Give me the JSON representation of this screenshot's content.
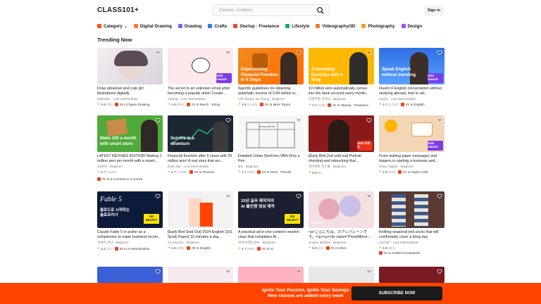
{
  "header": {
    "logo": "CLASS101+",
    "search_placeholder": "Classes, Creators",
    "signin_label": "Sign in"
  },
  "categories": [
    {
      "label": "Category",
      "color": "#ff5500"
    },
    {
      "label": "Digital Drawing",
      "color": "#ff7a33"
    },
    {
      "label": "Drawing",
      "color": "#8a5cf5"
    },
    {
      "label": "Crafts",
      "color": "#2b7de9"
    },
    {
      "label": "Startup · Freelance",
      "color": "#e84a2e"
    },
    {
      "label": "Lifestyle",
      "color": "#1fa37a"
    },
    {
      "label": "Videography/3D",
      "color": "#f07b3f"
    },
    {
      "label": "Photography",
      "color": "#e8a21e"
    },
    {
      "label": "Design",
      "color": "#a14cf0"
    }
  ],
  "section_title": "Trending Now",
  "cards": [
    {
      "title": "Draw attractive and cute girl illustrations digitally",
      "author": "kakmaku · Low Intermediate",
      "rating": "4.9",
      "count": "(78)",
      "rank": "#2 In Figure Drawing",
      "overlay": "",
      "badge": ""
    },
    {
      "title": "The secret to an unknown emoji artist becoming a popular artist! Create...",
      "author": "Yurang · Low Intermediate",
      "rating": "4.6",
      "count": "(954)",
      "rank": "#1 In Merch · Emoji",
      "overlay": "",
      "badge": "2025 Awards"
    },
    {
      "title": "Specific guidelines for obtaining automatic income of 9.99 million w...",
      "author": "Life Hacker Ja Chung · Beginner",
      "rating": "4.8",
      "count": "(2,160)",
      "rank": "#1 In More Topics",
      "overlay": "Experiencing Financial Freedom in 6 Steps",
      "badge": ""
    },
    {
      "title": "10 million won automatically comes into the bank account every month...",
      "author": "선한부자 오가닉 · Beginner",
      "rating": "4.7",
      "count": "(749)",
      "rank": "#1 In Startup · Freelance",
      "overlay": "Automating Earnings with a Blog",
      "badge": ""
    },
    {
      "title": "Fluent in English conversation without studying abroad, how to sel...",
      "author": "SiySiy · Low Intermediate",
      "rating": "4.7",
      "count": "(1,724)",
      "rank": "#1 In English",
      "overlay": "Speak English without traveling",
      "badge": "2024 Awards"
    },
    {
      "title": "LATEST REVISED EDITION! Making 1 million won per month with a smart...",
      "author": "JooPD · Beginner",
      "rating": "4.7",
      "count": "(1,630)",
      "rank": "#1 In E-Commerce In Korea",
      "overlay": "Make 100 a month with smart store",
      "badge": ""
    },
    {
      "title": "Financial freedom after 5 years with 20 million won! A real story that wo...",
      "author": "thejb.star · Low Intermediate",
      "rating": "4.7",
      "count": "(1,845)",
      "rank": "#2 In Finance",
      "overlay": "Survive in a downturn",
      "badge": ""
    },
    {
      "title": "Detailed Urban Sketches With Only a Pen",
      "author": "filni · Beginner",
      "rating": "4.7",
      "count": "(428)",
      "rank": "#4 In Pens · Pencils",
      "overlay": "",
      "badge": ""
    },
    {
      "title": "[Early Bird 2nd sold out] Portrait shooting and retouching that...",
      "author": "피아멘토 진드롬 · Beginner",
      "rating": "5.0",
      "count": "(8)",
      "rank": "",
      "overlay": "",
      "badge": "2025 어워즈"
    },
    {
      "title": "From making paper messages and toppers to starting a business and...",
      "author": "Shiny Topper · Beginner",
      "rating": "4.8",
      "count": "(278)",
      "rank": "#1 In Paper Craft",
      "overlay": "",
      "badge": "2025 Awards"
    },
    {
      "title": "Claude Fable 5 in action as a solopreneur to make business incom...",
      "author": "코세어 코너 · Beginner",
      "rating": "4.2",
      "count": "(21)",
      "rank": "#2 In AI Monetization",
      "overlay": "",
      "badge": ""
    },
    {
      "title": "[Early Bird Sold Out] 2024 English [101 Study Paper] 10 minutes a day,...",
      "author": "CLASS101 · Beginner",
      "rating": "4.6",
      "count": "(289)",
      "rank": "#5 In English",
      "overlay": "",
      "badge": ""
    },
    {
      "title": "A practical all-in-one content creation class that completes AI...",
      "author": "위키브레인 Z0A · Beginner",
      "rating": "4.7",
      "count": "(606)",
      "rank": "#1 In AI",
      "overlay": "",
      "badge": ""
    },
    {
      "title": "<p>こんにちは、スアレパレーンです。</p><p><br class=\"ProseMirror-...",
      "author": "Soiree, Balloon · Beginner",
      "rating": "5.0",
      "count": "(21)",
      "rank": "#1 In More",
      "overlay": "",
      "badge": ""
    },
    {
      "title": "Knitting seasonal knit socks that will comfortably cover a tiring day",
      "author": "LOOOF · Low Intermediate",
      "rating": "4.8",
      "count": "(201)",
      "rank": "#1 In Knitted Accessories",
      "overlay": "",
      "badge": ""
    }
  ],
  "thumb_texts": {
    "fable_title": "Fable 5",
    "fable_sub": "클로드로 시작하는 솔로프리너",
    "fable_select": "101 SELECT",
    "ai_line1": "15년 실무 제작자의",
    "ai_line2": "AI 올인원 영상 제작",
    "ai_select": "101 SELECT",
    "review_tag": "Reviews",
    "sketch_sign": "KENGAZETTE"
  },
  "banner": {
    "line1": "Ignite Your Passion, Ignite Your Savings",
    "line2": "New classes are added every week",
    "button_label": "SUBSCRIBE NOW"
  }
}
